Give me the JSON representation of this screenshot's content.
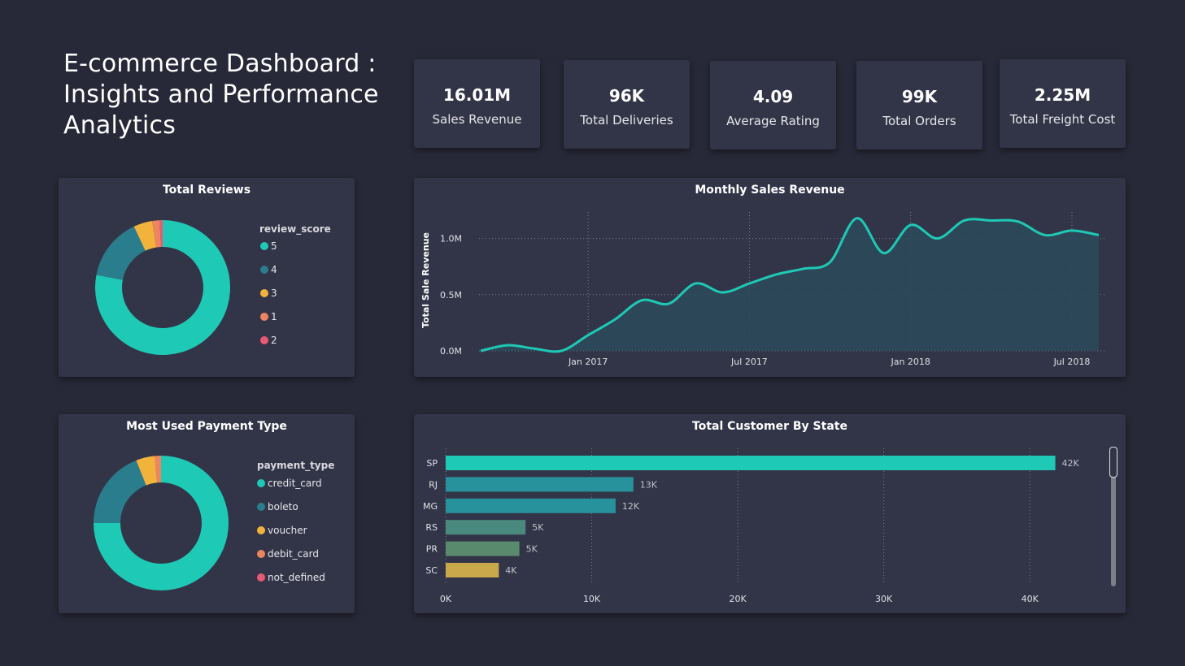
{
  "header": {
    "title": "E-commerce Dashboard :\nInsights and Performance\nAnalytics"
  },
  "kpis": [
    {
      "value": "16.01M",
      "label": "Sales Revenue"
    },
    {
      "value": "96K",
      "label": "Total Deliveries"
    },
    {
      "value": "4.09",
      "label": "Average Rating"
    },
    {
      "value": "99K",
      "label": "Total Orders"
    },
    {
      "value": "2.25M",
      "label": "Total Freight Cost"
    }
  ],
  "reviews": {
    "title": "Total Reviews",
    "legend_title": "review_score",
    "items": [
      {
        "label": "5",
        "color": "#1ec9b5",
        "share": 0.78
      },
      {
        "label": "4",
        "color": "#2a7d8c",
        "share": 0.15
      },
      {
        "label": "3",
        "color": "#f2b33d",
        "share": 0.045
      },
      {
        "label": "1",
        "color": "#ee8561",
        "share": 0.018
      },
      {
        "label": "2",
        "color": "#e85a74",
        "share": 0.007
      }
    ]
  },
  "payments": {
    "title": "Most Used Payment Type",
    "legend_title": "payment_type",
    "items": [
      {
        "label": "credit_card",
        "color": "#1ec9b5",
        "share": 0.75
      },
      {
        "label": "boleto",
        "color": "#2a7d8c",
        "share": 0.19
      },
      {
        "label": "voucher",
        "color": "#f2b33d",
        "share": 0.045
      },
      {
        "label": "debit_card",
        "color": "#ee8561",
        "share": 0.015
      },
      {
        "label": "not_defined",
        "color": "#e85a74",
        "share": 0.0
      }
    ]
  },
  "chart_data": [
    {
      "type": "area",
      "title": "Monthly Sales Revenue",
      "xlabel": "",
      "ylabel": "Total Sale Revenue",
      "x": [
        "2016-09",
        "2016-10",
        "2016-11",
        "2016-12",
        "2017-01",
        "2017-02",
        "2017-03",
        "2017-04",
        "2017-05",
        "2017-06",
        "2017-07",
        "2017-08",
        "2017-09",
        "2017-10",
        "2017-11",
        "2017-12",
        "2018-01",
        "2018-02",
        "2018-03",
        "2018-04",
        "2018-05",
        "2018-06",
        "2018-07",
        "2018-08"
      ],
      "values": [
        0.0,
        0.05,
        0.02,
        0.0,
        0.14,
        0.28,
        0.45,
        0.42,
        0.6,
        0.52,
        0.6,
        0.68,
        0.73,
        0.79,
        1.18,
        0.87,
        1.12,
        1.0,
        1.16,
        1.16,
        1.15,
        1.03,
        1.07,
        1.03
      ],
      "x_ticks": [
        "Jan 2017",
        "Jul 2017",
        "Jan 2018",
        "Jul 2018"
      ],
      "y_ticks": [
        "0.0M",
        "0.5M",
        "1.0M"
      ],
      "ylim": [
        0,
        1.25
      ],
      "color": "#1ec9b5",
      "fill": "#2b4a5c"
    },
    {
      "type": "bar",
      "title": "Total Customer By State",
      "categories": [
        "SP",
        "RJ",
        "MG",
        "RS",
        "PR",
        "SC"
      ],
      "values": [
        41746,
        12852,
        11635,
        5466,
        5045,
        3637
      ],
      "value_labels": [
        "42K",
        "13K",
        "12K",
        "5K",
        "5K",
        "4K"
      ],
      "colors": [
        "#1ec9b5",
        "#27929b",
        "#27929b",
        "#4a8a7e",
        "#5a8a6e",
        "#c8a84a"
      ],
      "x_ticks": [
        "0K",
        "10K",
        "20K",
        "30K",
        "40K"
      ],
      "xlim": [
        0,
        45000
      ],
      "orientation": "horizontal"
    }
  ]
}
